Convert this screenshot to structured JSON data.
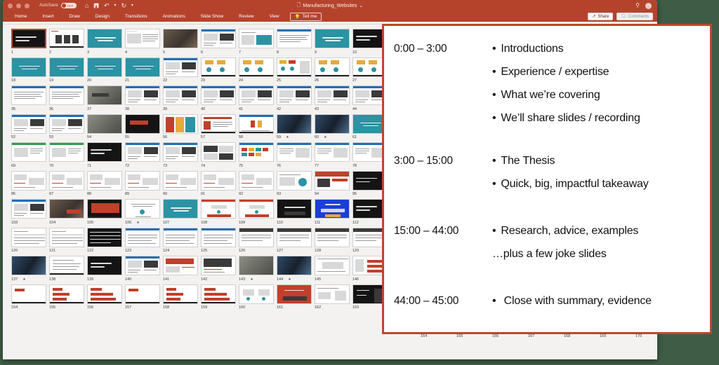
{
  "window": {
    "titlebar": {
      "autosave_label": "AutoSave",
      "autosave_state": "OFF",
      "document_title": "Manufacturing_Websites",
      "document_chevron": "⌄",
      "home_icon": "⌂",
      "save_icon": "὚B",
      "undo_icon": "↶",
      "undo_chevron": "⌄",
      "redo_icon": "↻",
      "more_icon": "▾",
      "search_icon": "⚲",
      "bg_color": "#b5432c"
    },
    "ribbon": {
      "tabs": [
        {
          "label": "Home",
          "active": true
        },
        {
          "label": "Insert",
          "active": false
        },
        {
          "label": "Draw",
          "active": false
        },
        {
          "label": "Design",
          "active": false
        },
        {
          "label": "Transitions",
          "active": false
        },
        {
          "label": "Animations",
          "active": false
        },
        {
          "label": "Slide Show",
          "active": false
        },
        {
          "label": "Review",
          "active": false
        },
        {
          "label": "View",
          "active": false
        }
      ],
      "tell_me": {
        "label": "Tell me",
        "icon": "Ὂ1"
      },
      "share": {
        "label": "Share",
        "icon": "↗"
      },
      "comments": {
        "label": "Comments",
        "icon": "὞8"
      }
    }
  },
  "sorter": {
    "selected_slide": 1,
    "rows": [
      {
        "numbers": [
          1,
          2,
          3,
          4,
          5,
          6,
          7,
          8,
          9,
          10
        ],
        "styles": [
          "dark-title",
          "white-faces",
          "teal-text",
          "white-table",
          "photo-man",
          "white-web",
          "white-chart",
          "white-doc",
          "teal-text",
          "dark-title"
        ],
        "stars": []
      },
      {
        "numbers": [
          18,
          19,
          20,
          21,
          22,
          23,
          24,
          25,
          26,
          27
        ],
        "styles": [
          "teal-text",
          "teal-text",
          "teal-text",
          "teal-text",
          "white-web",
          "white-diagram",
          "white-diagram",
          "white-diagram2",
          "white-diagram",
          "white-diagram"
        ],
        "stars": []
      },
      {
        "numbers": [
          35,
          36,
          37,
          38,
          39,
          40,
          41,
          42,
          43,
          44
        ],
        "styles": [
          "white-doc",
          "white-doc",
          "photo-dark",
          "white-web",
          "white-web",
          "white-web",
          "white-web",
          "white-web",
          "white-web",
          "white-web"
        ],
        "stars": []
      },
      {
        "numbers": [
          52,
          53,
          54,
          55,
          56,
          57,
          58,
          59,
          60,
          61
        ],
        "styles": [
          "white-web",
          "white-web",
          "photo-face",
          "dark-banner",
          "color-bars",
          "white-article",
          "white-people",
          "photo-tech",
          "photo-tech",
          "teal-text"
        ],
        "stars": [
          59,
          60
        ]
      },
      {
        "numbers": [
          69,
          70,
          71,
          72,
          73,
          74,
          75,
          76,
          77,
          78
        ],
        "styles": [
          "white-green",
          "white-green",
          "dark-title",
          "white-web",
          "white-web",
          "white-collage",
          "white-grid",
          "white-doc2",
          "white-doc2",
          "white-doc2"
        ],
        "stars": []
      },
      {
        "numbers": [
          86,
          87,
          88,
          89,
          90,
          91,
          92,
          93,
          94,
          95
        ],
        "styles": [
          "white-wire",
          "white-wire",
          "white-wire",
          "white-wire",
          "white-wire",
          "white-wire",
          "white-wire",
          "white-chart2",
          "red-banner",
          "dark-title"
        ],
        "stars": []
      },
      {
        "numbers": [
          103,
          104,
          105,
          106,
          107,
          108,
          109,
          110,
          111,
          112
        ],
        "styles": [
          "white-web",
          "photo-crowd",
          "dark-video",
          "white-quote",
          "teal-text",
          "white-form",
          "white-form",
          "dark-panel",
          "blue-panel",
          "dark-title"
        ],
        "stars": [
          106
        ]
      },
      {
        "numbers": [
          120,
          121,
          122,
          123,
          124,
          125,
          126,
          127,
          128,
          129
        ],
        "styles": [
          "white-table2",
          "white-table2",
          "dark-table",
          "white-blue",
          "white-blue",
          "white-blue",
          "white-dark2",
          "white-dark2",
          "white-dark2",
          "white-dark2"
        ],
        "stars": []
      },
      {
        "numbers": [
          137,
          138,
          139,
          140,
          141,
          142,
          143,
          144,
          145,
          146
        ],
        "styles": [
          "photo-city",
          "white-bullets",
          "dark-title",
          "white-web",
          "white-redweb",
          "white-tech",
          "photo-face2",
          "photo-tech",
          "white-doc3",
          "white-wire2"
        ],
        "stars": [
          137,
          143,
          144
        ]
      },
      {
        "numbers": [
          154,
          155,
          156,
          157,
          158,
          159,
          160,
          161,
          162,
          163
        ],
        "styles": [
          "white-redbar",
          "white-redbar2",
          "white-redbar3",
          "white-redbar",
          "white-redbar2",
          "white-redbar3",
          "white-cards",
          "red-pattern",
          "white-chart3",
          "dark-mobile"
        ],
        "stars": []
      }
    ],
    "tail_row": {
      "numbers": [
        164,
        165,
        166,
        167,
        168,
        169,
        170
      ],
      "styles": [
        "dark-title",
        "white-doc4",
        "white-doc4",
        "white-doc4",
        "white-doc4",
        "white-table3",
        "dark-promo"
      ]
    }
  },
  "overlay": {
    "border_color": "#c0462b",
    "groups": [
      {
        "time": "0:00 – 3:00",
        "items": [
          {
            "bullet": "•",
            "text": "Introductions"
          },
          {
            "bullet": "•",
            "text": "Experience / expertise"
          },
          {
            "bullet": "•",
            "text": "What we’re covering"
          },
          {
            "bullet": "•",
            "text": "We’ll share slides / recording"
          }
        ]
      },
      {
        "time": "3:00 – 15:00",
        "items": [
          {
            "bullet": "•",
            "text": "The Thesis"
          },
          {
            "bullet": "•",
            "text": "Quick, big, impactful takeaway"
          }
        ]
      },
      {
        "time": "15:00 – 44:00",
        "items": [
          {
            "bullet": "•",
            "text": "Research, advice, examples"
          },
          {
            "bullet": "",
            "text": "…plus a few joke slides"
          }
        ]
      },
      {
        "time": "44:00 – 45:00",
        "items": [
          {
            "bullet": "•",
            "text": " Close with summary, evidence"
          }
        ]
      }
    ]
  }
}
